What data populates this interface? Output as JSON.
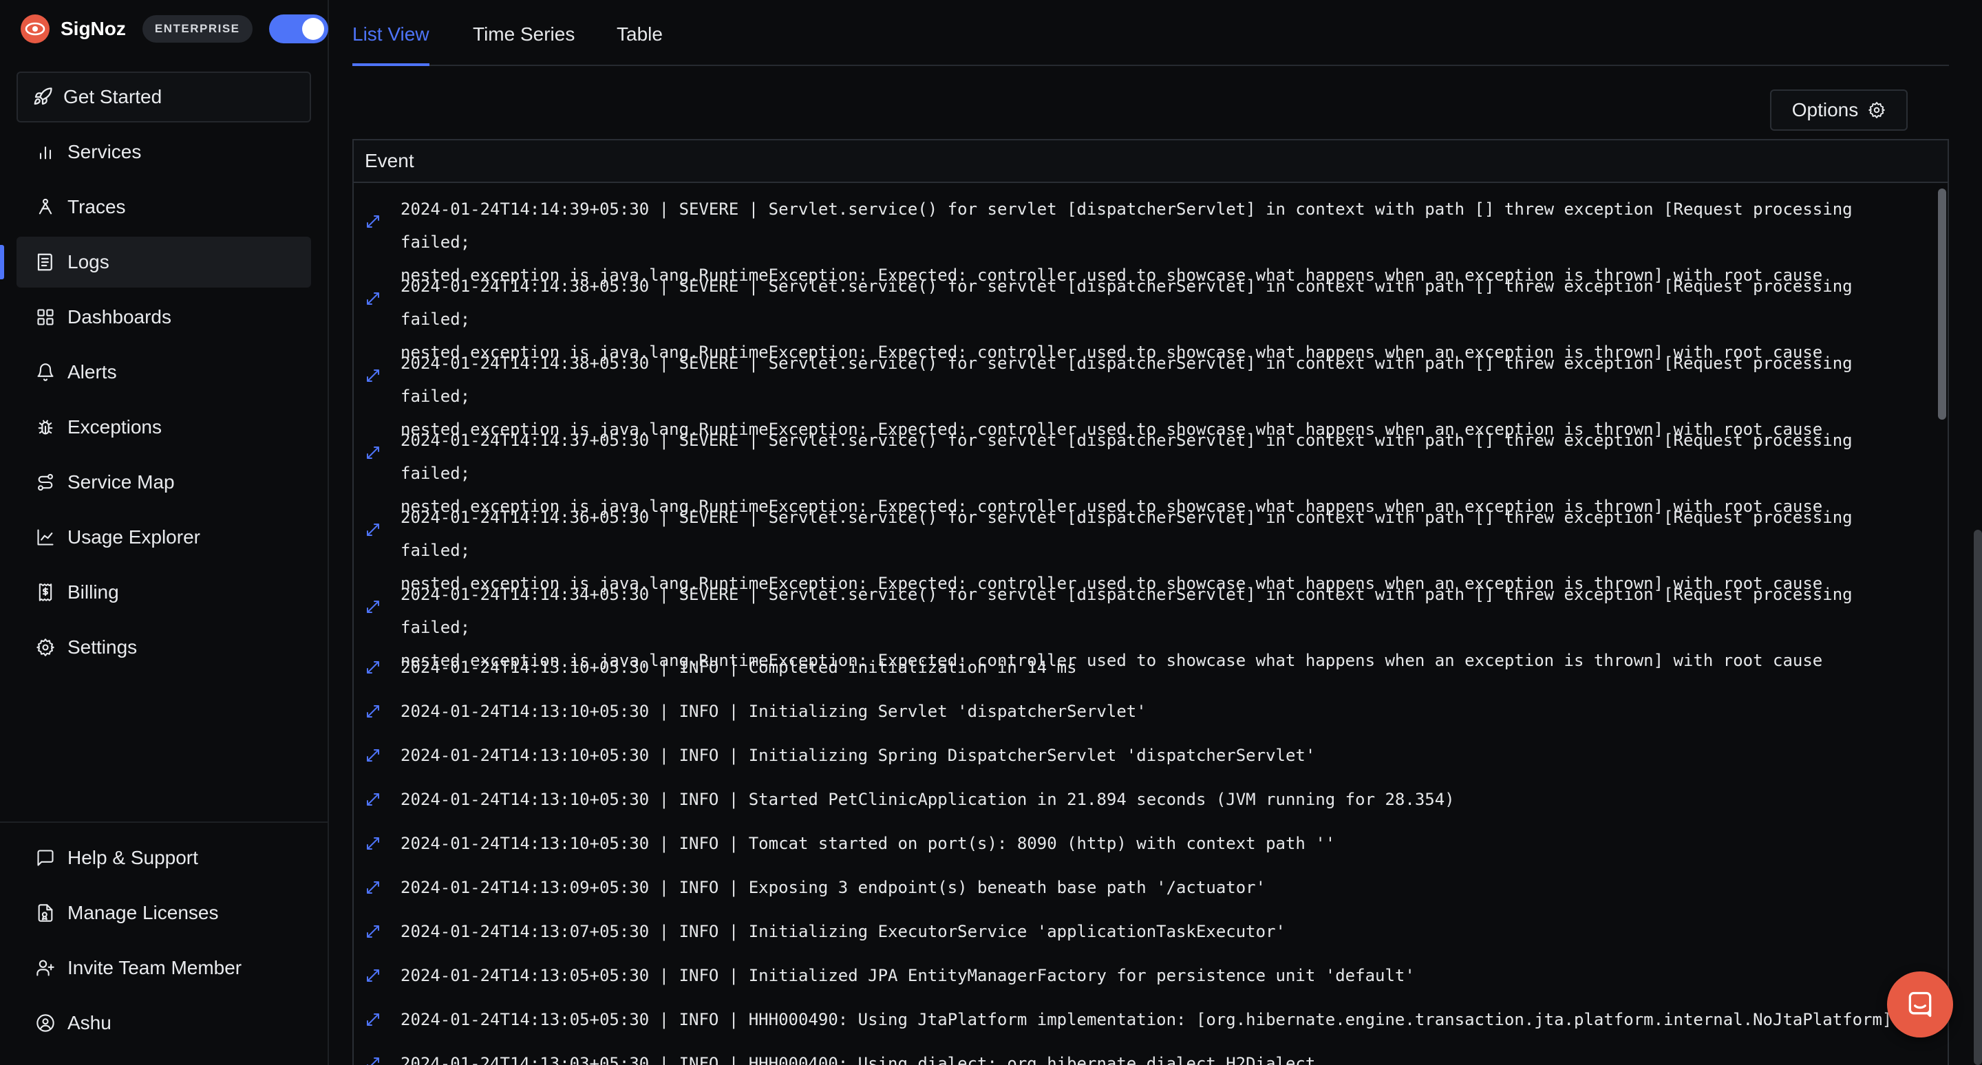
{
  "brand": {
    "name": "SigNoz",
    "edition_badge": "ENTERPRISE"
  },
  "sidebar": {
    "items": [
      {
        "label": "Get Started",
        "icon": "rocket-icon"
      },
      {
        "label": "Services",
        "icon": "bar-chart-icon"
      },
      {
        "label": "Traces",
        "icon": "traces-icon"
      },
      {
        "label": "Logs",
        "icon": "logs-icon",
        "active": true
      },
      {
        "label": "Dashboards",
        "icon": "dashboard-icon"
      },
      {
        "label": "Alerts",
        "icon": "bell-icon"
      },
      {
        "label": "Exceptions",
        "icon": "bug-icon"
      },
      {
        "label": "Service Map",
        "icon": "route-icon"
      },
      {
        "label": "Usage Explorer",
        "icon": "line-chart-icon"
      },
      {
        "label": "Billing",
        "icon": "receipt-icon"
      },
      {
        "label": "Settings",
        "icon": "gear-icon"
      }
    ],
    "bottom_items": [
      {
        "label": "Help & Support",
        "icon": "message-icon"
      },
      {
        "label": "Manage Licenses",
        "icon": "license-icon"
      },
      {
        "label": "Invite Team Member",
        "icon": "user-plus-icon"
      },
      {
        "label": "Ashu",
        "icon": "user-circle-icon"
      }
    ]
  },
  "tabs": [
    {
      "label": "List View",
      "active": true
    },
    {
      "label": "Time Series"
    },
    {
      "label": "Table"
    }
  ],
  "options_label": "Options",
  "event_header": "Event",
  "logs": [
    {
      "line1": "2024-01-24T14:14:39+05:30 | SEVERE | Servlet.service() for servlet [dispatcherServlet] in context with path [] threw exception [Request processing failed;",
      "line2": "nested exception is java.lang.RuntimeException: Expected: controller used to showcase what happens when an exception is thrown] with root cause"
    },
    {
      "line1": "2024-01-24T14:14:38+05:30 | SEVERE | Servlet.service() for servlet [dispatcherServlet] in context with path [] threw exception [Request processing failed;",
      "line2": "nested exception is java.lang.RuntimeException: Expected: controller used to showcase what happens when an exception is thrown] with root cause"
    },
    {
      "line1": "2024-01-24T14:14:38+05:30 | SEVERE | Servlet.service() for servlet [dispatcherServlet] in context with path [] threw exception [Request processing failed;",
      "line2": "nested exception is java.lang.RuntimeException: Expected: controller used to showcase what happens when an exception is thrown] with root cause"
    },
    {
      "line1": "2024-01-24T14:14:37+05:30 | SEVERE | Servlet.service() for servlet [dispatcherServlet] in context with path [] threw exception [Request processing failed;",
      "line2": "nested exception is java.lang.RuntimeException: Expected: controller used to showcase what happens when an exception is thrown] with root cause"
    },
    {
      "line1": "2024-01-24T14:14:36+05:30 | SEVERE | Servlet.service() for servlet [dispatcherServlet] in context with path [] threw exception [Request processing failed;",
      "line2": "nested exception is java.lang.RuntimeException: Expected: controller used to showcase what happens when an exception is thrown] with root cause"
    },
    {
      "line1": "2024-01-24T14:14:34+05:30 | SEVERE | Servlet.service() for servlet [dispatcherServlet] in context with path [] threw exception [Request processing failed;",
      "line2": "nested exception is java.lang.RuntimeException: Expected: controller used to showcase what happens when an exception is thrown] with root cause"
    },
    {
      "line1": "2024-01-24T14:13:10+05:30 | INFO | Completed initialization in 14 ms"
    },
    {
      "line1": "2024-01-24T14:13:10+05:30 | INFO | Initializing Servlet 'dispatcherServlet'"
    },
    {
      "line1": "2024-01-24T14:13:10+05:30 | INFO | Initializing Spring DispatcherServlet 'dispatcherServlet'"
    },
    {
      "line1": "2024-01-24T14:13:10+05:30 | INFO | Started PetClinicApplication in 21.894 seconds (JVM running for 28.354)"
    },
    {
      "line1": "2024-01-24T14:13:10+05:30 | INFO | Tomcat started on port(s): 8090 (http) with context path ''"
    },
    {
      "line1": "2024-01-24T14:13:09+05:30 | INFO | Exposing 3 endpoint(s) beneath base path '/actuator'"
    },
    {
      "line1": "2024-01-24T14:13:07+05:30 | INFO | Initializing ExecutorService 'applicationTaskExecutor'"
    },
    {
      "line1": "2024-01-24T14:13:05+05:30 | INFO | Initialized JPA EntityManagerFactory for persistence unit 'default'"
    },
    {
      "line1": "2024-01-24T14:13:05+05:30 | INFO | HHH000490: Using JtaPlatform implementation: [org.hibernate.engine.transaction.jta.platform.internal.NoJtaPlatform]"
    },
    {
      "line1": "2024-01-24T14:13:03+05:30 | INFO | HHH000400: Using dialect: org.hibernate.dialect.H2Dialect"
    }
  ],
  "colors": {
    "accent": "#4e74f8",
    "brand": "#e75a43",
    "background": "#0b0c0e"
  }
}
